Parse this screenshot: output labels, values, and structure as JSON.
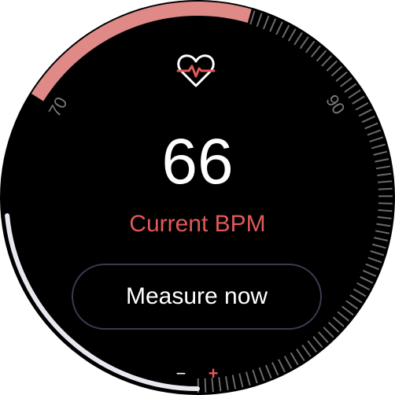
{
  "gauge": {
    "scale_labels": [
      "70",
      "90"
    ],
    "scale_min": 60,
    "scale_max": 100,
    "current_value": 66,
    "colors": {
      "target_zone": "#e08a88",
      "progress_arc": "#e8e8f0",
      "ticks": "#6b6b6b",
      "label": "#7a7a7a"
    }
  },
  "heart_icon": "heart-pulse-icon",
  "heart_color": "#e05a57",
  "reading": {
    "value": "66",
    "label": "Current BPM"
  },
  "actions": {
    "measure_label": "Measure now",
    "decrease_label": "−",
    "increase_label": "+"
  }
}
